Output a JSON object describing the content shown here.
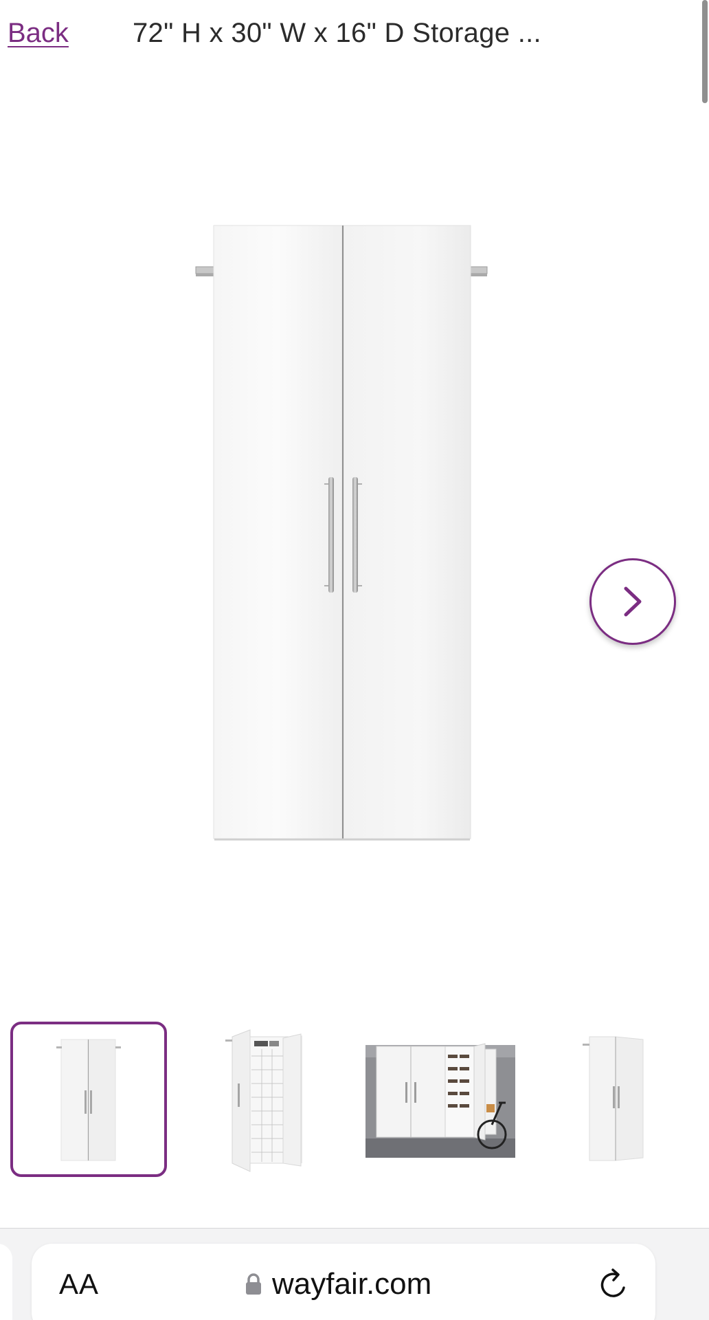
{
  "header": {
    "back_label": "Back",
    "title": "72\" H x 30\" W x 16\" D Storage ..."
  },
  "gallery": {
    "main_image_icon": "white-two-door-cabinet",
    "next_icon": "chevron-right-icon",
    "thumbnails": [
      {
        "icon": "cabinet-closed-front",
        "selected": true
      },
      {
        "icon": "cabinet-open-shoe-rack",
        "selected": false
      },
      {
        "icon": "cabinet-garage-scene",
        "selected": false
      },
      {
        "icon": "cabinet-closed-angled",
        "selected": false
      }
    ]
  },
  "browser": {
    "text_size_label": "AA",
    "url": "wayfair.com",
    "lock_icon": "lock-icon",
    "reload_icon": "reload-icon"
  },
  "colors": {
    "accent": "#7b2d82",
    "text": "#2b2b2b"
  }
}
